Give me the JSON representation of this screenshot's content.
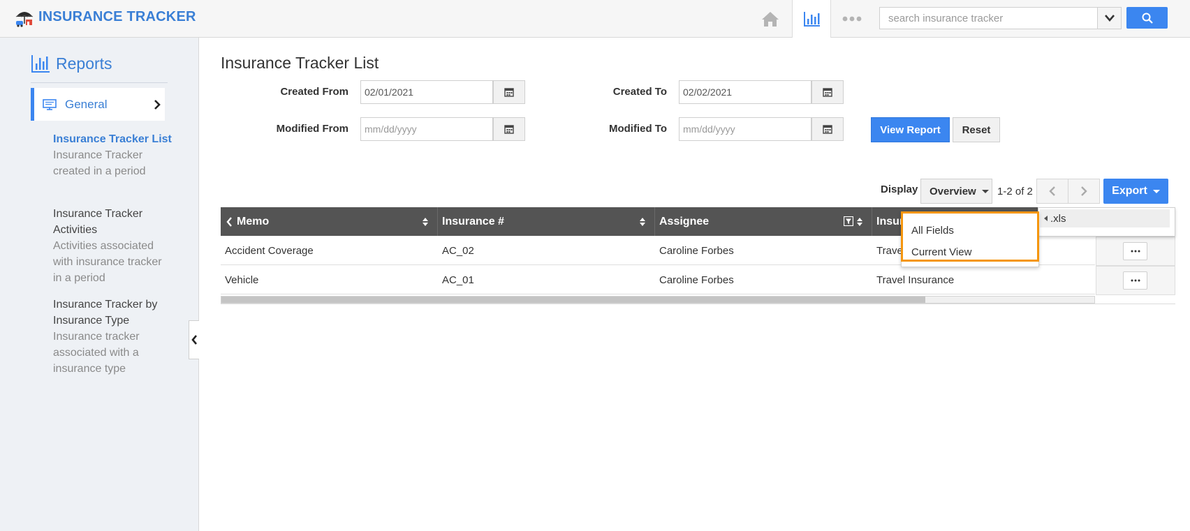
{
  "app": {
    "title": "INSURANCE TRACKER"
  },
  "topnav": {
    "icons": [
      "home-icon",
      "bar-chart-icon",
      "more-icon"
    ],
    "search_placeholder": "search insurance tracker"
  },
  "sidebar": {
    "title": "Reports",
    "section": "General",
    "links": [
      {
        "title": "Insurance Tracker List",
        "desc": "Insurance Tracker created in a period",
        "active": true
      },
      {
        "title": "Insurance Tracker Activities",
        "desc": "Activities associated with insurance tracker in a period",
        "active": false
      },
      {
        "title": "Insurance Tracker by Insurance Type",
        "desc": "Insurance tracker associated with a insurance type",
        "active": false
      }
    ]
  },
  "main": {
    "title": "Insurance Tracker List",
    "filters": {
      "created_from_label": "Created From",
      "created_from_value": "02/01/2021",
      "created_to_label": "Created To",
      "created_to_value": "02/02/2021",
      "modified_from_label": "Modified From",
      "modified_from_placeholder": "mm/dd/yyyy",
      "modified_to_label": "Modified To",
      "modified_to_placeholder": "mm/dd/yyyy"
    },
    "buttons": {
      "view_report": "View Report",
      "reset": "Reset"
    },
    "toolbar": {
      "display_label": "Display",
      "display_value": "Overview",
      "pager": "1-2 of 2",
      "export_label": "Export"
    },
    "export_menu": {
      "format": ".xls",
      "options": [
        "All Fields",
        "Current View"
      ]
    },
    "table": {
      "columns": [
        "Memo",
        "Insurance #",
        "Assignee",
        "Insur"
      ],
      "rows": [
        [
          "Accident Coverage",
          "AC_02",
          "Caroline Forbes",
          "Travel Insurance"
        ],
        [
          "Vehicle",
          "AC_01",
          "Caroline Forbes",
          "Travel Insurance"
        ]
      ]
    }
  },
  "colors": {
    "accent": "#3b86f0",
    "brand_text": "#3a7fd5",
    "header_bg": "#545454",
    "highlight": "#f5960e"
  }
}
